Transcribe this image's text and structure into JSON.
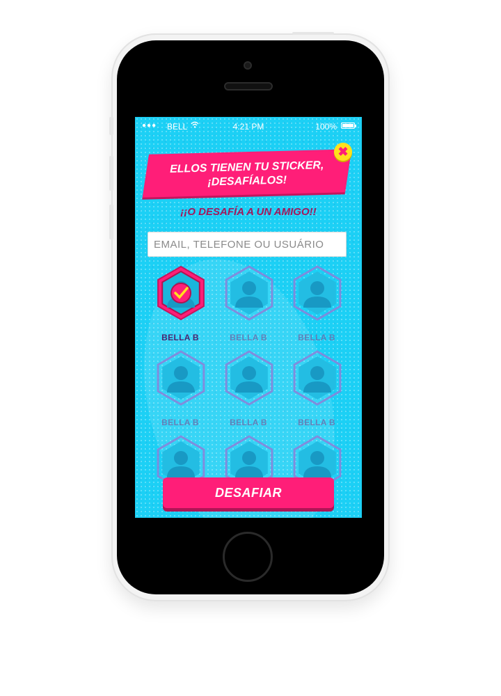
{
  "status_bar": {
    "signal": "●●●",
    "carrier": "BELL",
    "time": "4:21 PM",
    "battery": "100%"
  },
  "header": {
    "banner_line1": "ELLOS TIENEN TU STICKER,",
    "banner_line2": "¡DESAFÍALOS!",
    "close_glyph": "✖"
  },
  "subtitle": "¡¡O DESAFÍA A UN AMIGO!!",
  "search": {
    "placeholder": "EMAIL, TELEFONE OU USUÁRIO",
    "value": ""
  },
  "friends": [
    {
      "name": "BELLA B",
      "selected": true
    },
    {
      "name": "BELLA B",
      "selected": false
    },
    {
      "name": "BELLA B",
      "selected": false
    },
    {
      "name": "BELLA B",
      "selected": false
    },
    {
      "name": "BELLA B",
      "selected": false
    },
    {
      "name": "BELLA B",
      "selected": false
    },
    {
      "name": "",
      "selected": false
    },
    {
      "name": "",
      "selected": false
    },
    {
      "name": "",
      "selected": false
    }
  ],
  "cta": {
    "label": "DESAFIAR"
  },
  "colors": {
    "background": "#1cd0f5",
    "accent_pink": "#ff1e78",
    "close_yellow": "#ffe11c",
    "subtitle": "#a3185c",
    "name_text": "#63448c"
  },
  "icons": {
    "signal": "signal-dots-icon",
    "wifi": "wifi-icon",
    "battery": "battery-icon",
    "close": "close-icon",
    "avatar": "user-silhouette-icon",
    "check": "checkmark-icon"
  }
}
